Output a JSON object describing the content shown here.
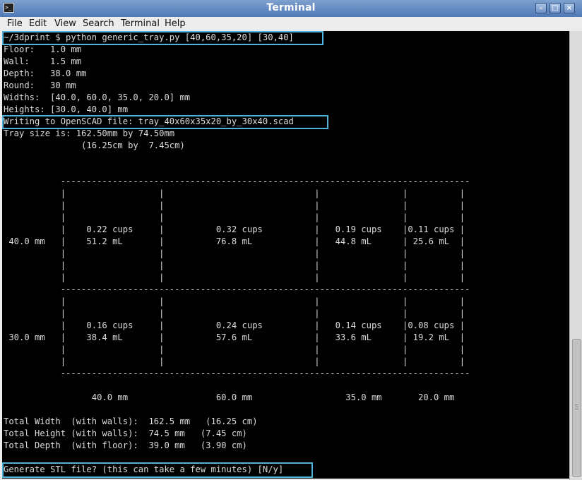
{
  "window": {
    "title": "Terminal",
    "buttons": {
      "minimize": "–",
      "maximize": "□",
      "close": "×"
    }
  },
  "menu": [
    "File",
    "Edit",
    "View",
    "Search",
    "Terminal",
    "Help"
  ],
  "terminal": {
    "lines": [
      "~/3dprint $ python generic_tray.py [40,60,35,20] [30,40]",
      "Floor:   1.0 mm",
      "Wall:    1.5 mm",
      "Depth:   38.0 mm",
      "Round:   30 mm",
      "Widths:  [40.0, 60.0, 35.0, 20.0] mm",
      "Heights: [30.0, 40.0] mm",
      "Writing to OpenSCAD file: tray_40x60x35x20_by_30x40.scad",
      "Tray size is: 162.50mm by 74.50mm",
      "               (16.25cm by  7.45cm)",
      "",
      "",
      "           -------------------------------------------------------------------------------",
      "           |                  |                             |                |          |",
      "           |                  |                             |                |          |",
      "           |                  |                             |                |          |",
      "           |    0.22 cups     |          0.32 cups          |   0.19 cups    |0.11 cups |",
      " 40.0 mm   |    51.2 mL       |          76.8 mL            |   44.8 mL      | 25.6 mL  |",
      "           |                  |                             |                |          |",
      "           |                  |                             |                |          |",
      "           |                  |                             |                |          |",
      "           -------------------------------------------------------------------------------",
      "           |                  |                             |                |          |",
      "           |                  |                             |                |          |",
      "           |    0.16 cups     |          0.24 cups          |   0.14 cups    |0.08 cups |",
      " 30.0 mm   |    38.4 mL       |          57.6 mL            |   33.6 mL      | 19.2 mL  |",
      "           |                  |                             |                |          |",
      "           |                  |                             |                |          |",
      "           -------------------------------------------------------------------------------",
      "",
      "                 40.0 mm                 60.0 mm                  35.0 mm       20.0 mm",
      "",
      "Total Width  (with walls):  162.5 mm   (16.25 cm)",
      "Total Height (with walls):  74.5 mm   (7.45 cm)",
      "Total Depth  (with floor):  39.0 mm   (3.90 cm)",
      "",
      "Generate STL file? (this can take a few minutes) [N/y]"
    ]
  }
}
